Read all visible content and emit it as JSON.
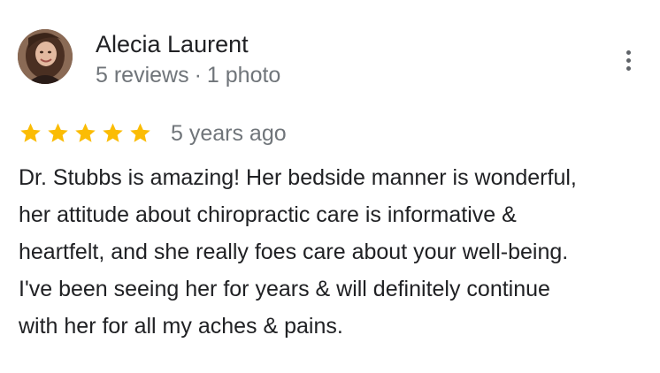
{
  "reviewer": {
    "name": "Alecia Laurent",
    "reviews_count": "5 reviews",
    "separator": "·",
    "photos_count": "1 photo"
  },
  "rating": {
    "stars": 5,
    "max": 5,
    "star_color": "#fbbc04",
    "icon": "star-icon"
  },
  "review": {
    "date": "5 years ago",
    "lines": [
      "Dr. Stubbs is amazing! Her bedside manner is wonderful,",
      "her attitude about chiropractic care is informative &",
      "heartfelt, and she really foes care about your well-being.",
      "I've been seeing her for years & will definitely continue",
      "with her for all my aches & pains."
    ]
  },
  "menu": {
    "icon": "more-vert-icon"
  }
}
